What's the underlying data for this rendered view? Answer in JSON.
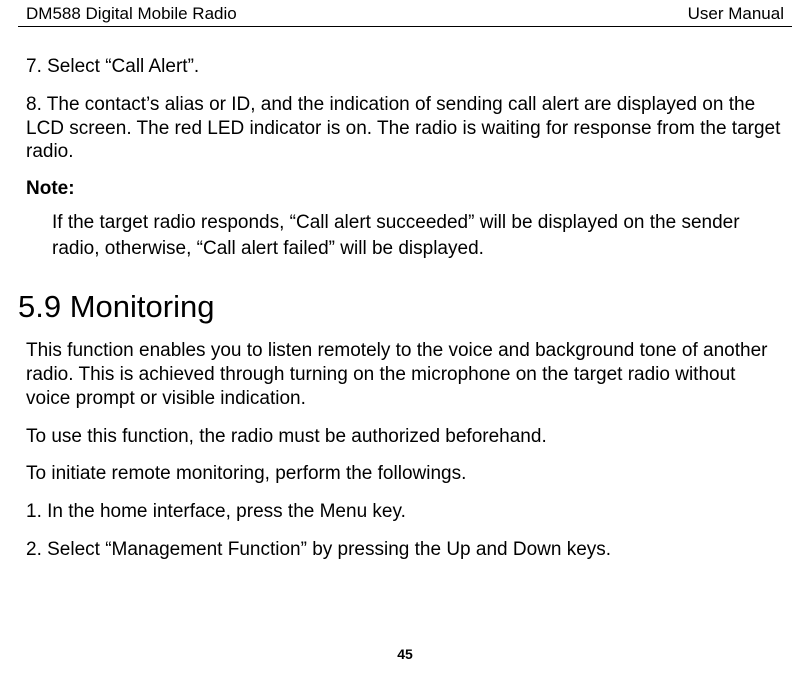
{
  "header": {
    "left": "DM588 Digital Mobile Radio",
    "right": "User Manual"
  },
  "body": {
    "step7": "7. Select “Call Alert”.",
    "step8": "8. The contact’s alias or ID, and the indication of sending call alert are displayed on the LCD screen. The red LED indicator is on. The radio is waiting for response from the target radio.",
    "note_label": "Note:",
    "note_body": "If the target radio responds, “Call alert succeeded” will be displayed on the sender radio, otherwise, “Call alert failed” will be displayed.",
    "section_heading": "5.9 Monitoring",
    "monitoring_intro": "This function enables you to listen remotely to the voice and background tone of another radio. This is achieved through turning on the microphone on the target radio without voice prompt or visible indication.",
    "monitoring_auth": "To use this function, the radio must be authorized beforehand.",
    "monitoring_initiate": "To initiate remote monitoring, perform the followings.",
    "mon_step1": "1. In the home interface, press the Menu key.",
    "mon_step2": "2. Select “Management Function” by pressing the Up and Down keys."
  },
  "footer": {
    "page_number": "45"
  }
}
